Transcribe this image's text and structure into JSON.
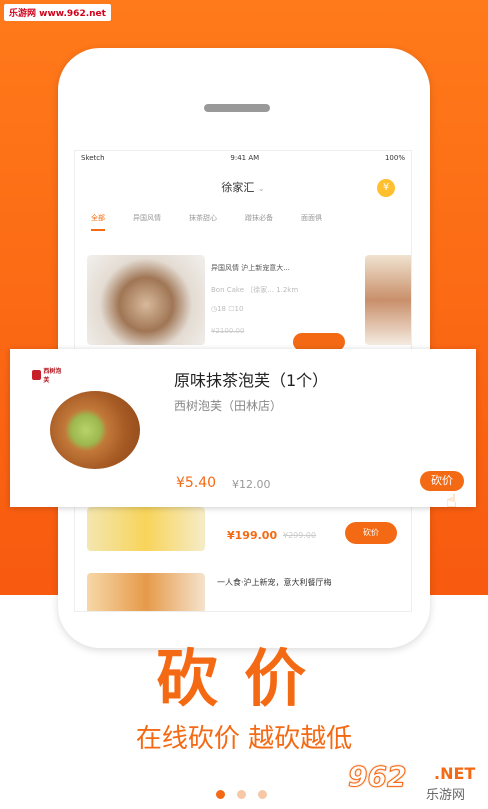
{
  "watermark_top": "乐游网 www.962.net",
  "status_bar": {
    "carrier": "Sketch",
    "time": "9:41 AM",
    "battery": "100%"
  },
  "shop_header": {
    "title": "徐家汇",
    "chevron": "⌄",
    "coin_icon": "coin-icon"
  },
  "tabs": [
    {
      "label": "全部",
      "active": true
    },
    {
      "label": "异国风情",
      "active": false
    },
    {
      "label": "抹茶甜心",
      "active": false
    },
    {
      "label": "蹭抹必备",
      "active": false
    },
    {
      "label": "面面俱",
      "active": false
    }
  ],
  "bg_card": {
    "name": "异国风情 沪上新宠意大...",
    "subtitle": "Bon Cake 〔徐家...   1.2km",
    "stock": "◷18   ☐10",
    "old_price": "¥2100.00"
  },
  "lemon_card": {
    "price": "¥199.00",
    "old_price": "¥299.00",
    "button": "砍价"
  },
  "third_card": {
    "name": "一人食·沪上新宠，意大利餐厅梅"
  },
  "featured": {
    "brand": "西树泡芙",
    "title": "原味抹茶泡芙（1个）",
    "subtitle": "西树泡芙（田林店）",
    "price": "¥5.40",
    "old_price": "¥12.00",
    "button": "砍价",
    "hand_icon": "hand-pointer-icon"
  },
  "hero": {
    "title": "砍价",
    "slogan": "在线砍价 越砍越低"
  },
  "pager": {
    "count": 3,
    "active": 0
  },
  "watermark_logo": {
    "number": "962",
    "suffix": ".NET",
    "cn": "乐游网"
  },
  "colors": {
    "accent": "#f46a14",
    "background_top": "#ff7a1a"
  }
}
